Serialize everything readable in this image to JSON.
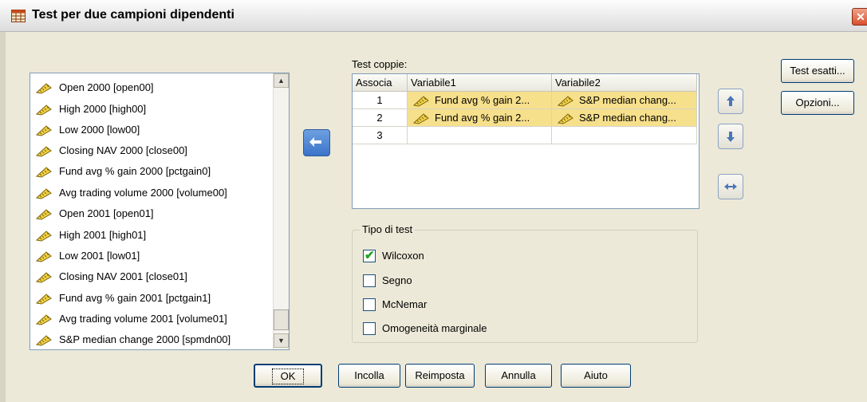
{
  "window": {
    "title": "Test per due campioni dipendenti",
    "close_glyph": "✕"
  },
  "source_list": {
    "items": [
      "Open 2000 [open00]",
      "High 2000 [high00]",
      "Low 2000 [low00]",
      "Closing NAV 2000 [close00]",
      "Fund avg % gain 2000 [pctgain0]",
      "Avg trading volume 2000 [volume00]",
      "Open 2001 [open01]",
      "High 2001 [high01]",
      "Low 2001 [low01]",
      "Closing NAV 2001 [close01]",
      "Fund avg % gain 2001 [pctgain1]",
      "Avg trading volume 2001 [volume01]",
      "S&P median change 2000 [spmdn00]"
    ]
  },
  "pairs": {
    "label": "Test coppie:",
    "columns": [
      "Associa",
      "Variabile1",
      "Variabile2"
    ],
    "rows": [
      {
        "num": "1",
        "var1": "Fund avg % gain 2...",
        "var2": "S&P median chang..."
      },
      {
        "num": "2",
        "var1": "Fund avg % gain 2...",
        "var2": "S&P median chang..."
      },
      {
        "num": "3",
        "var1": "",
        "var2": ""
      }
    ]
  },
  "test_type": {
    "legend": "Tipo di test",
    "options": [
      {
        "label": "Wilcoxon",
        "checked": true
      },
      {
        "label": "Segno",
        "checked": false
      },
      {
        "label": "McNemar",
        "checked": false
      },
      {
        "label": "Omogeneità marginale",
        "checked": false
      }
    ]
  },
  "side_buttons": {
    "exact_tests": "Test esatti...",
    "options": "Opzioni..."
  },
  "bottom_buttons": {
    "ok": "OK",
    "paste": "Incolla",
    "reset": "Reimposta",
    "cancel": "Annulla",
    "help": "Aiuto"
  },
  "icons": {
    "move": "arrow-left-icon",
    "up": "arrow-up-icon",
    "down": "arrow-down-icon",
    "swap": "swap-icon",
    "variable": "ruler-icon"
  }
}
